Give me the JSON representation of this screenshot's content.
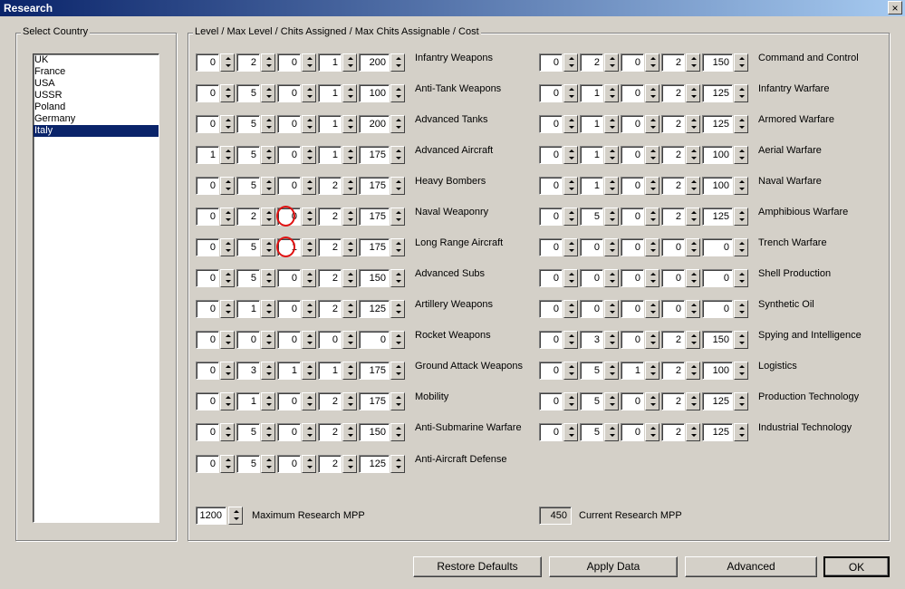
{
  "window": {
    "title": "Research",
    "close_glyph": "×"
  },
  "country_panel": {
    "label": "Select Country",
    "countries": [
      "UK",
      "France",
      "USA",
      "USSR",
      "Poland",
      "Germany",
      "Italy"
    ],
    "selected": "Italy"
  },
  "research_panel": {
    "label": "Level / Max Level / Chits Assigned / Max Chits Assignable / Cost",
    "left_column": [
      {
        "name": "Infantry Weapons",
        "values": [
          "0",
          "2",
          "0",
          "1",
          "200"
        ]
      },
      {
        "name": "Anti-Tank Weapons",
        "values": [
          "0",
          "5",
          "0",
          "1",
          "100"
        ]
      },
      {
        "name": "Advanced Tanks",
        "values": [
          "0",
          "5",
          "0",
          "1",
          "200"
        ]
      },
      {
        "name": "Advanced Aircraft",
        "values": [
          "1",
          "5",
          "0",
          "1",
          "175"
        ]
      },
      {
        "name": "Heavy Bombers",
        "values": [
          "0",
          "5",
          "0",
          "2",
          "175"
        ]
      },
      {
        "name": "Naval Weaponry",
        "values": [
          "0",
          "2",
          "0",
          "2",
          "175"
        ],
        "highlight": 2
      },
      {
        "name": "Long Range Aircraft",
        "values": [
          "0",
          "5",
          "1",
          "2",
          "175"
        ],
        "highlight": 2
      },
      {
        "name": "Advanced Subs",
        "values": [
          "0",
          "5",
          "0",
          "2",
          "150"
        ]
      },
      {
        "name": "Artillery Weapons",
        "values": [
          "0",
          "1",
          "0",
          "2",
          "125"
        ]
      },
      {
        "name": "Rocket Weapons",
        "values": [
          "0",
          "0",
          "0",
          "0",
          "0"
        ]
      },
      {
        "name": "Ground Attack Weapons",
        "values": [
          "0",
          "3",
          "1",
          "1",
          "175"
        ]
      },
      {
        "name": "Mobility",
        "values": [
          "0",
          "1",
          "0",
          "2",
          "175"
        ]
      },
      {
        "name": "Anti-Submarine Warfare",
        "values": [
          "0",
          "5",
          "0",
          "2",
          "150"
        ]
      },
      {
        "name": "Anti-Aircraft Defense",
        "values": [
          "0",
          "5",
          "0",
          "2",
          "125"
        ]
      }
    ],
    "right_column": [
      {
        "name": "Command and Control",
        "values": [
          "0",
          "2",
          "0",
          "2",
          "150"
        ]
      },
      {
        "name": "Infantry Warfare",
        "values": [
          "0",
          "1",
          "0",
          "2",
          "125"
        ]
      },
      {
        "name": "Armored Warfare",
        "values": [
          "0",
          "1",
          "0",
          "2",
          "125"
        ]
      },
      {
        "name": "Aerial Warfare",
        "values": [
          "0",
          "1",
          "0",
          "2",
          "100"
        ]
      },
      {
        "name": "Naval Warfare",
        "values": [
          "0",
          "1",
          "0",
          "2",
          "100"
        ]
      },
      {
        "name": "Amphibious Warfare",
        "values": [
          "0",
          "5",
          "0",
          "2",
          "125"
        ]
      },
      {
        "name": "Trench Warfare",
        "values": [
          "0",
          "0",
          "0",
          "0",
          "0"
        ]
      },
      {
        "name": "Shell Production",
        "values": [
          "0",
          "0",
          "0",
          "0",
          "0"
        ]
      },
      {
        "name": "Synthetic Oil",
        "values": [
          "0",
          "0",
          "0",
          "0",
          "0"
        ]
      },
      {
        "name": "Spying and Intelligence",
        "values": [
          "0",
          "3",
          "0",
          "2",
          "150"
        ]
      },
      {
        "name": "Logistics",
        "values": [
          "0",
          "5",
          "1",
          "2",
          "100"
        ]
      },
      {
        "name": "Production Technology",
        "values": [
          "0",
          "5",
          "0",
          "2",
          "125"
        ]
      },
      {
        "name": "Industrial Technology",
        "values": [
          "0",
          "5",
          "0",
          "2",
          "125"
        ]
      }
    ],
    "max_mpp": {
      "value": "1200",
      "label": "Maximum Research MPP"
    },
    "current_mpp": {
      "value": "450",
      "label": "Current Research MPP"
    }
  },
  "buttons": {
    "restore": "Restore Defaults",
    "apply": "Apply Data",
    "advanced": "Advanced",
    "ok": "OK"
  }
}
